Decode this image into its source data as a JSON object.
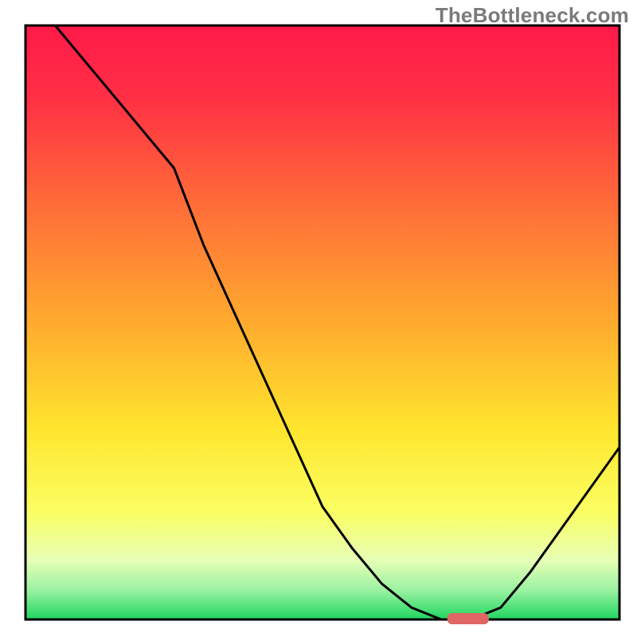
{
  "watermark": "TheBottleneck.com",
  "chart_data": {
    "type": "line",
    "title": "",
    "xlabel": "",
    "ylabel": "",
    "xlim": [
      0,
      100
    ],
    "ylim": [
      0,
      100
    ],
    "grid": false,
    "series": [
      {
        "name": "curve",
        "x": [
          5,
          10,
          15,
          20,
          25,
          30,
          35,
          40,
          45,
          50,
          55,
          60,
          65,
          70,
          75,
          80,
          85,
          90,
          95,
          100
        ],
        "values": [
          100,
          94,
          88,
          82,
          76,
          63,
          52,
          41,
          30,
          19,
          12,
          6,
          2,
          0,
          0,
          2,
          8,
          15,
          22,
          29
        ]
      }
    ],
    "marker": {
      "x_start": 71,
      "x_end": 78,
      "y": 0
    },
    "gradient_stops": [
      {
        "offset": 0.0,
        "color": "#ff1a49"
      },
      {
        "offset": 0.12,
        "color": "#ff2f45"
      },
      {
        "offset": 0.3,
        "color": "#ff6c38"
      },
      {
        "offset": 0.5,
        "color": "#ffab2e"
      },
      {
        "offset": 0.68,
        "color": "#ffe52e"
      },
      {
        "offset": 0.82,
        "color": "#fbff63"
      },
      {
        "offset": 0.9,
        "color": "#e6ffb5"
      },
      {
        "offset": 0.95,
        "color": "#9cf2a3"
      },
      {
        "offset": 1.0,
        "color": "#1fd65f"
      }
    ],
    "marker_color": "#e06666",
    "curve_color": "#000000",
    "axes_color": "#000000"
  }
}
